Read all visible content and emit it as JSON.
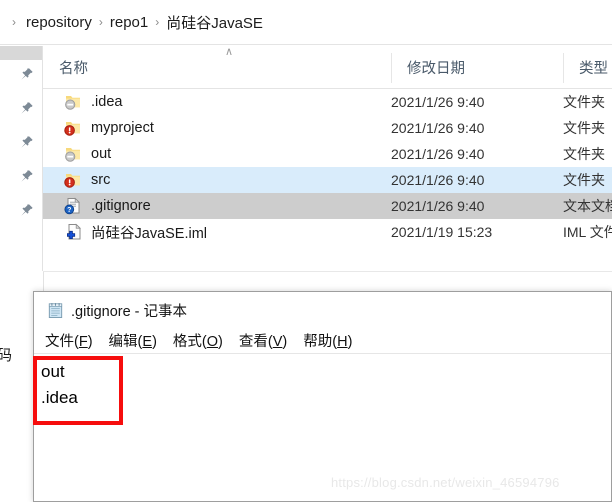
{
  "explorer": {
    "breadcrumb": {
      "name": "address-bar",
      "leading_chevron": "›",
      "separator": "›",
      "items": [
        {
          "label": "repository"
        },
        {
          "label": "repo1"
        },
        {
          "label": "尚硅谷JavaSE"
        }
      ]
    },
    "nav_pane": {
      "pin_count": 5,
      "pin_icon": "pin-icon"
    },
    "columns": [
      {
        "key": "name",
        "label": "名称",
        "sort_indicator": "∧"
      },
      {
        "key": "date",
        "label": "修改日期"
      },
      {
        "key": "type",
        "label": "类型"
      }
    ],
    "files": [
      {
        "name": ".idea",
        "date": "2021/1/26 9:40",
        "type": "文件夹",
        "icon": "folder-ignored-icon",
        "state": "normal"
      },
      {
        "name": "myproject",
        "date": "2021/1/26 9:40",
        "type": "文件夹",
        "icon": "folder-modified-icon",
        "state": "normal"
      },
      {
        "name": "out",
        "date": "2021/1/26 9:40",
        "type": "文件夹",
        "icon": "folder-ignored-icon",
        "state": "normal"
      },
      {
        "name": "src",
        "date": "2021/1/26 9:40",
        "type": "文件夹",
        "icon": "folder-modified-icon",
        "state": "hover"
      },
      {
        "name": ".gitignore",
        "date": "2021/1/26 9:40",
        "type": "文本文档",
        "icon": "file-unknown-icon",
        "state": "selected"
      },
      {
        "name": "尚硅谷JavaSE.iml",
        "date": "2021/1/19 15:23",
        "type": "IML 文件",
        "icon": "file-added-icon",
        "state": "normal"
      }
    ],
    "background_text": "码"
  },
  "notepad": {
    "title": ".gitignore - 记事本",
    "icon": "notepad-icon",
    "menu": [
      {
        "label": "文件(",
        "accel": "F",
        "tail": ")"
      },
      {
        "label": "编辑(",
        "accel": "E",
        "tail": ")"
      },
      {
        "label": "格式(",
        "accel": "O",
        "tail": ")"
      },
      {
        "label": "查看(",
        "accel": "V",
        "tail": ")"
      },
      {
        "label": "帮助(",
        "accel": "H",
        "tail": ")"
      }
    ],
    "content_lines": [
      "out",
      ".idea"
    ]
  },
  "annotation": {
    "type": "red-rectangle",
    "color": "#f60d0d"
  },
  "watermark": {
    "text": "https://blog.csdn.net/weixin_46594796"
  }
}
